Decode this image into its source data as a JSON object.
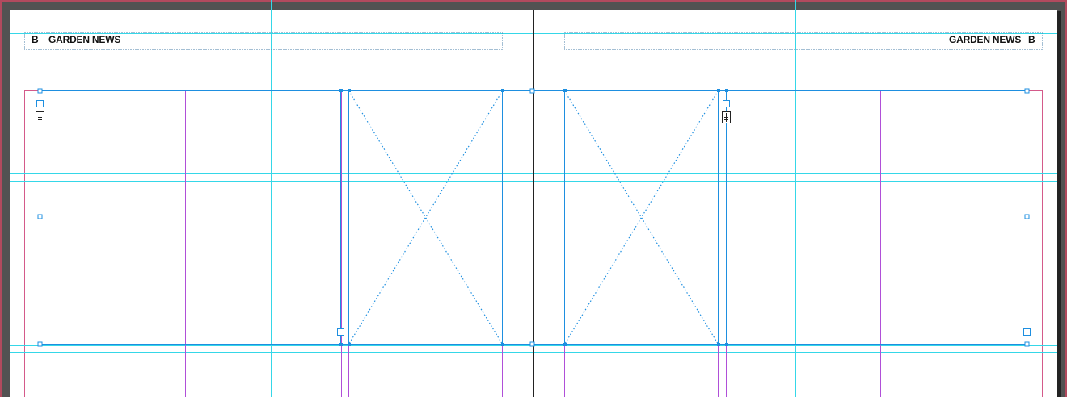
{
  "left_page": {
    "header": {
      "marker": "B",
      "title": "GARDEN NEWS"
    }
  },
  "right_page": {
    "header": {
      "title": "GARDEN NEWS",
      "marker": "B"
    }
  },
  "colors": {
    "pasteboard": "#525252",
    "page": "#ffffff",
    "guide": "#35d7e8",
    "margin": "#c04ad6",
    "bleed": "#d45a8a",
    "frame_selection": "#1e8fe0",
    "spine": "#222222"
  },
  "icons": [
    "threaded-text-icon",
    "image-placeholder-frame-icon"
  ]
}
